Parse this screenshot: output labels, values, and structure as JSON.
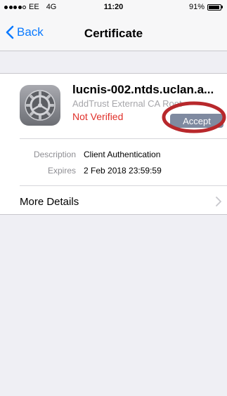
{
  "status_bar": {
    "carrier": "EE",
    "network": "4G",
    "time": "11:20",
    "battery_text": "91%",
    "battery_level": 0.91,
    "signal_bars": 4
  },
  "nav": {
    "back_label": "Back",
    "title": "Certificate"
  },
  "certificate": {
    "name": "lucnis-002.ntds.uclan.a...",
    "issuer": "AddTrust External CA Root",
    "status": "Not Verified",
    "accept_label": "Accept",
    "details": [
      {
        "label": "Description",
        "value": "Client Authentication"
      },
      {
        "label": "Expires",
        "value": "2 Feb 2018 23:59:59"
      }
    ],
    "more_details_label": "More Details"
  },
  "colors": {
    "accent": "#0a7aff",
    "status_red": "#e0302a",
    "accept_bg": "#7f8aa0",
    "annotation_circle": "#b8282c"
  },
  "icons": {
    "back": "chevron-left-icon",
    "more": "chevron-right-icon",
    "certificate": "settings-gear-icon"
  }
}
